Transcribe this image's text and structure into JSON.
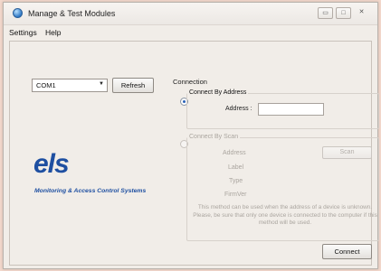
{
  "window": {
    "title": "Manage & Test Modules",
    "controls": {
      "minimize": "▭",
      "maximize": "□",
      "close": "✕"
    }
  },
  "menu": [
    "Settings",
    "Help"
  ],
  "port": {
    "selected": "COM1",
    "refresh_label": "Refresh"
  },
  "logo": {
    "text": "els",
    "tagline": "Monitoring & Access Control Systems"
  },
  "connection": {
    "label": "Connection",
    "by_address": {
      "title": "Connect By Address",
      "selected": true,
      "address_label": "Address :",
      "address_value": ""
    },
    "by_scan": {
      "title": "Connect By Scan",
      "selected": false,
      "enabled": false,
      "address_label": "Address",
      "scan_label": "Scan",
      "label_label": "Label",
      "type_label": "Type",
      "firmver_label": "FirmVer",
      "note": "This method can be used when the address of a device is unknown. Please, be sure that only one device is connected to the computer if this method will be used."
    },
    "connect_label": "Connect"
  },
  "colors": {
    "brand": "#1e4fa1",
    "disabled_text": "#aaa59f",
    "background": "#f3d8cc"
  }
}
